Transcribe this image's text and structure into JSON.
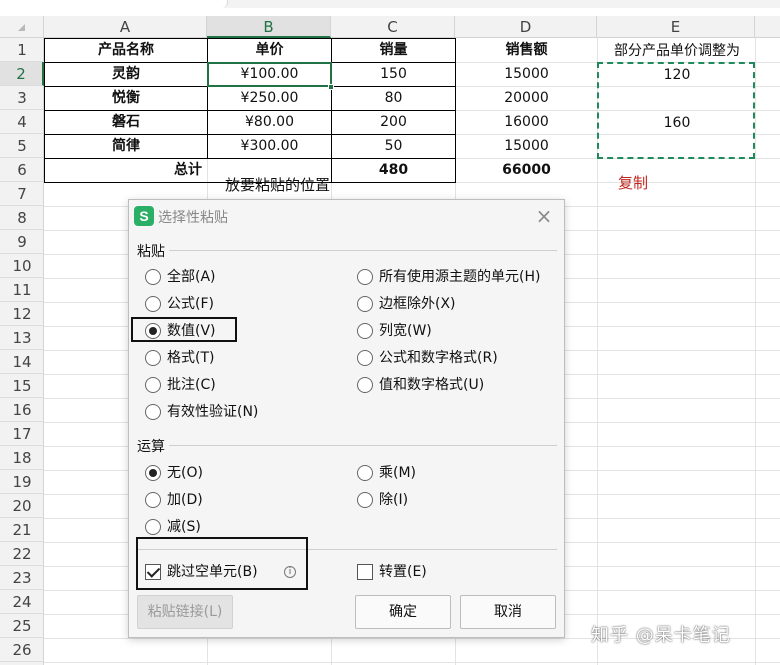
{
  "columns": [
    "A",
    "B",
    "C",
    "D",
    "E"
  ],
  "rows": [
    "1",
    "2",
    "3",
    "4",
    "5",
    "6",
    "7",
    "8",
    "9",
    "10",
    "11",
    "12",
    "13",
    "14",
    "15",
    "16",
    "17",
    "18",
    "19",
    "20",
    "21",
    "22",
    "23",
    "24",
    "25",
    "26"
  ],
  "table": {
    "headers": [
      "产品名称",
      "单价",
      "销量",
      "销售额"
    ],
    "rows": [
      [
        "灵韵",
        "¥100.00",
        "150",
        "15000"
      ],
      [
        "悦衡",
        "¥250.00",
        "80",
        "20000"
      ],
      [
        "磐石",
        "¥80.00",
        "200",
        "16000"
      ],
      [
        "简律",
        "¥300.00",
        "50",
        "15000"
      ]
    ],
    "total_label": "总计",
    "total_qty": "480",
    "total_sales": "66000"
  },
  "side": {
    "e1_label": "部分产品单价调整为",
    "e2_value": "120",
    "e4_value": "160",
    "copy_label": "复制",
    "paste_label": "放要粘贴的位置"
  },
  "dialog": {
    "logo": "S",
    "title": "选择性粘贴",
    "close": "×",
    "paste_section": "粘贴",
    "paste_left": [
      "全部(A)",
      "公式(F)",
      "数值(V)",
      "格式(T)",
      "批注(C)",
      "有效性验证(N)"
    ],
    "paste_right": [
      "所有使用源主题的单元(H)",
      "边框除外(X)",
      "列宽(W)",
      "公式和数字格式(R)",
      "值和数字格式(U)"
    ],
    "paste_selected": "数值(V)",
    "op_section": "运算",
    "op_left": [
      "无(O)",
      "加(D)",
      "减(S)"
    ],
    "op_right": [
      "乘(M)",
      "除(I)"
    ],
    "op_selected": "无(O)",
    "skip_blanks": "跳过空单元(B)",
    "skip_blanks_checked": true,
    "info_icon": "i",
    "transpose": "转置(E)",
    "transpose_checked": false,
    "paste_link": "粘贴链接(L)",
    "ok": "确定",
    "cancel": "取消"
  },
  "watermark": "知乎 @呆卡笔记",
  "colors": {
    "accent_green": "#217346",
    "copy_red": "#c0271f",
    "logo_green": "#2bae66"
  }
}
